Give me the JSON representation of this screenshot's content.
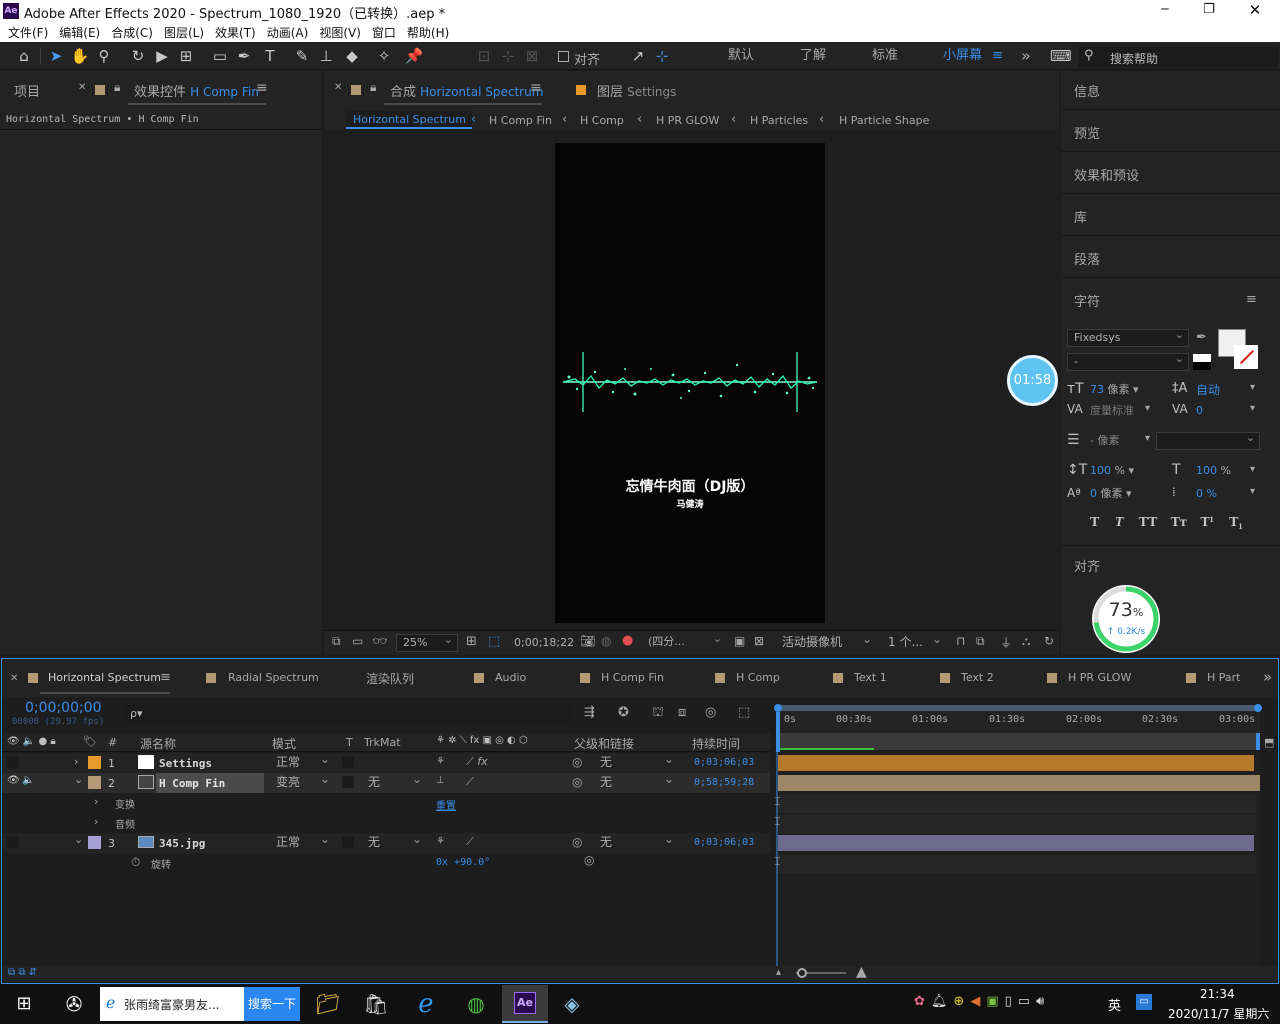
{
  "window": {
    "title": "Adobe After Effects 2020 - Spectrum_1080_1920（已转换）.aep *",
    "app_icon": "Ae",
    "minimize": "─",
    "maximize": "❐",
    "close": "✕"
  },
  "menu": [
    "文件(F)",
    "编辑(E)",
    "合成(C)",
    "图层(L)",
    "效果(T)",
    "动画(A)",
    "视图(V)",
    "窗口",
    "帮助(H)"
  ],
  "toolbar": {
    "align_label": "对齐",
    "workspaces": [
      "默认",
      "了解",
      "标准",
      "小屏幕"
    ],
    "more": "»",
    "search_placeholder": "搜索帮助"
  },
  "left_panel": {
    "tab_project": "项目",
    "tab_effects": "效果控件",
    "effects_target": "H Comp Fin",
    "breadcrumb": "Horizontal Spectrum • H Comp Fin"
  },
  "comp_panel": {
    "tab_label": "合成",
    "tab_comp": "Horizontal Spectrum",
    "tab_layer_label": "图层",
    "tab_layer_name": "Settings",
    "nav": [
      "Horizontal Spectrum",
      "H Comp Fin",
      "H Comp",
      "H PR GLOW",
      "H Particles",
      "H Particle Shape"
    ],
    "nav_sep": "‹",
    "song_title": "忘情牛肉面（DJ版）",
    "artist": "马健涛",
    "zoom": "25%",
    "timecode": "0;00;18;22",
    "resolution": "(四分...",
    "camera": "活动摄像机",
    "views": "1 个..."
  },
  "timer_badge": "01:58",
  "right_panel": {
    "items": [
      "信息",
      "预览",
      "效果和预设",
      "库",
      "段落"
    ],
    "char_title": "字符",
    "font": "Fixedsys",
    "font_style": "-",
    "font_size": "73",
    "px": "像素",
    "leading": "自动",
    "kerning": "度量标准",
    "tracking": "0",
    "stroke": "- 像素",
    "vscale": "100",
    "hscale": "100",
    "pct": "%",
    "baseline": "0",
    "baseline_unit": "像素",
    "tsume": "0 %",
    "text_styles": [
      "T",
      "T",
      "TT",
      "Tт",
      "T¹",
      "T₁"
    ],
    "align_title": "对齐",
    "perf_value": "73",
    "perf_unit": "%",
    "perf_rate": "↑ 0.2K/s",
    "perf_fraction": 0.73,
    "perf_color": "#3ad46a"
  },
  "timeline": {
    "tabs": [
      "Horizontal Spectrum",
      "Radial Spectrum",
      "渲染队列",
      "Audio",
      "H Comp Fin",
      "H Comp",
      "Text 1",
      "Text 2",
      "H PR GLOW",
      "H Part"
    ],
    "tab_colors": [
      "#b49a74",
      "#b49a74",
      "",
      "#b49a74",
      "#b49a74",
      "#b49a74",
      "#b49a74",
      "#b49a74",
      "#b49a74",
      "#b49a74"
    ],
    "timecode": "0;00;00;00",
    "frame_info": "00000 (29.97 fps)",
    "search_placeholder": "ρ▾",
    "headers": {
      "num": "#",
      "source": "源名称",
      "mode": "模式",
      "t": "T",
      "trkmat": "TrkMat",
      "parent": "父级和链接",
      "duration": "持续时间"
    },
    "ruler": [
      "0s",
      "00:30s",
      "01:00s",
      "01:30s",
      "02:00s",
      "02:30s",
      "03:00s"
    ],
    "layers": [
      {
        "num": "1",
        "name": "Settings",
        "color": "#e89a2a",
        "mode": "正常",
        "trkmat": "",
        "parent": "无",
        "duration": "0;03;06;03",
        "bar_color": "#b5792a"
      },
      {
        "num": "2",
        "name": "H Comp Fin",
        "color": "#b49a74",
        "mode": "变亮",
        "trkmat": "无",
        "parent": "无",
        "duration": "0;58;59;28",
        "bar_color": "#9c8866"
      },
      {
        "num": "3",
        "name": "345.jpg",
        "color": "#a7a0d4",
        "mode": "正常",
        "trkmat": "无",
        "parent": "无",
        "duration": "0;03;06;03",
        "bar_color": "#6e6a8c"
      }
    ],
    "sub_transform": "变换",
    "sub_reset": "重置",
    "sub_audio": "音频",
    "sub_rotate": "旋转",
    "rotate_value": "0x +90.0°"
  },
  "taskbar": {
    "search_text": "张雨绮富豪男友...",
    "search_button": "搜索一下",
    "ime": "英",
    "time": "21:34",
    "date": "2020/11/7 星期六"
  }
}
